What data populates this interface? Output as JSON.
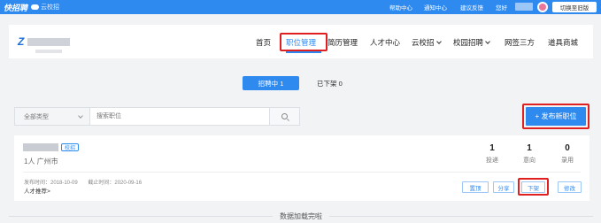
{
  "topbar": {
    "logo_text": "快招聘",
    "logo_sub": "云校招",
    "links": [
      "帮助中心",
      "通知中心",
      "建议反馈",
      "您好"
    ],
    "switch_label": "切换至旧版"
  },
  "nav": {
    "items": [
      "首页",
      "职位管理",
      "简历管理",
      "人才中心",
      "云校招",
      "校园招聘",
      "网签三方",
      "道具商城"
    ],
    "active": "职位管理"
  },
  "brand": {
    "mark": "Z"
  },
  "tabs": {
    "active_label": "招聘中 1",
    "other_label": "已下架 0"
  },
  "search": {
    "type_label": "全部类型",
    "placeholder": "搜索职位"
  },
  "publish_label": "+ 发布新职位",
  "job": {
    "tag": "校招",
    "meta": "1人 广州市",
    "stats": [
      {
        "num": "1",
        "label": "投递"
      },
      {
        "num": "1",
        "label": "意向"
      },
      {
        "num": "0",
        "label": "录用"
      }
    ],
    "publish_date": "发布时间：2018-10-09",
    "end_date": "截止时间：2020-09-16",
    "recommend": "人才推荐>",
    "actions": [
      "置顶",
      "分享",
      "下架",
      "修改"
    ]
  },
  "footer_text": "数据加载完啦",
  "colors": {
    "primary": "#2f8af0",
    "highlight": "#e02020"
  }
}
